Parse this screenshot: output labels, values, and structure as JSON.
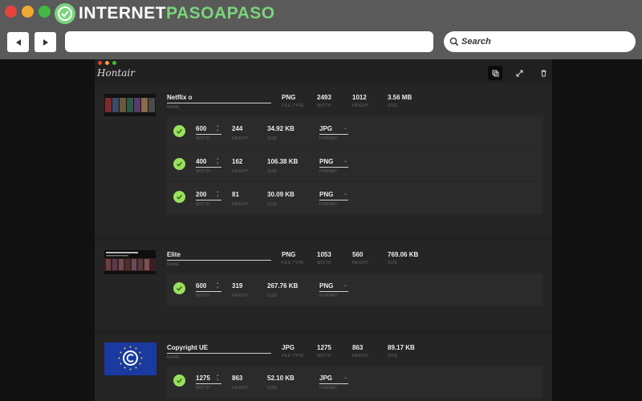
{
  "browser": {
    "brand_part1": "INTERNET",
    "brand_part2": "PASOAPASO",
    "search_label": "Search"
  },
  "app": {
    "logo_text": "Hontair",
    "toolbar": {
      "icons": [
        "select-icon",
        "resize-icon",
        "trash-icon"
      ]
    },
    "labels": {
      "name": "NAME",
      "file_type": "FILE TYPE",
      "width": "WIDTH",
      "height": "HEIGHT",
      "size": "SIZE",
      "format": "FORMAT"
    },
    "files": [
      {
        "name": "Netflix o",
        "file_type": "PNG",
        "width": "2493",
        "height": "1012",
        "size": "3.56 MB",
        "variants": [
          {
            "width": "600",
            "height": "244",
            "size": "34.92 KB",
            "format": "JPG"
          },
          {
            "width": "400",
            "height": "162",
            "size": "106.38 KB",
            "format": "PNG"
          },
          {
            "width": "200",
            "height": "81",
            "size": "30.09 KB",
            "format": "PNG"
          }
        ]
      },
      {
        "name": "Elite",
        "file_type": "PNG",
        "width": "1053",
        "height": "560",
        "size": "769.06 KB",
        "variants": [
          {
            "width": "600",
            "height": "319",
            "size": "267.76 KB",
            "format": "PNG"
          }
        ]
      },
      {
        "name": "Copyright UE",
        "file_type": "JPG",
        "width": "1275",
        "height": "863",
        "size": "89.17 KB",
        "variants": [
          {
            "width": "1275",
            "height": "863",
            "size": "52.10 KB",
            "format": "JPG"
          }
        ]
      }
    ]
  }
}
